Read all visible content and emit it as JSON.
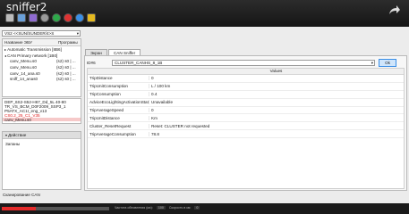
{
  "app": {
    "title": "sniffer2"
  },
  "toolbar": {
    "icons": [
      "new-icon",
      "open-icon",
      "save-icon",
      "settings-icon",
      "connect-icon",
      "record-icon",
      "refresh-icon",
      "help-icon"
    ]
  },
  "left": {
    "combo_value": "VS2 <<SUN/SUNDER/4>S",
    "tree_header": {
      "name": "Название ЭБУ",
      "programs": "Програмы"
    },
    "tree_items": [
      {
        "label": "Automatic Transmission [8B6]",
        "value": ""
      },
      {
        "label": "CAN Primary network [1B0]",
        "value": ""
      },
      {
        "label": "canv_Menu.s0",
        "value": "(s2) s0 | ..."
      },
      {
        "label": "canv_Menu.s0",
        "value": "(s2) s0 | ..."
      },
      {
        "label": "canv_14_ana.s0",
        "value": "(s2) s0 | ..."
      },
      {
        "label": "sniff_14_anas0",
        "value": "(s2) s0 | ..."
      }
    ],
    "info_lines": [
      "DEP_6S2-S52-H67_Dd_5L 40-80",
      "TR_VS_BCM_D0F2009_SSP3_1",
      "P5ATX_AC1I_eng_v13",
      "CS0.2_25_C1_V35",
      "canv_Menu.s0"
    ],
    "actions": {
      "title": "Действие",
      "label": "Запаны"
    }
  },
  "right": {
    "tabs": [
      "Экран",
      "CAN Sniffer"
    ],
    "active_tab": 1,
    "id_label": "ID#6",
    "frame_select": "CLUSTER_CANHS_8_1B",
    "button_label": "Ok",
    "grid_header": "Values",
    "rows": [
      {
        "name": "TripDistance",
        "value": "0"
      },
      {
        "name": "TripUnitConsumption",
        "value": "L / 100 km"
      },
      {
        "name": "TripConsumption",
        "value": "0.4"
      },
      {
        "name": "AdviceEcoLightingActivationStat",
        "value": "Unavailable"
      },
      {
        "name": "TripAverageSpeed",
        "value": "0"
      },
      {
        "name": "TripUnitDistance",
        "value": "Km"
      },
      {
        "name": "Cluster_ResetRequest",
        "value": "Reset: CLUSTER not requested"
      },
      {
        "name": "TripAverageConsumption",
        "value": "78.8"
      }
    ]
  },
  "status": {
    "text": "Сканирование CAN"
  },
  "footer": {
    "fields": [
      "Частота обновления (мс):",
      "100",
      "Скорость в км:",
      "0"
    ],
    "progress": 0.32
  },
  "colors": {
    "accent": "#3a8ee6",
    "progress": "#e32a2a",
    "highlight_red": "#e12020"
  }
}
